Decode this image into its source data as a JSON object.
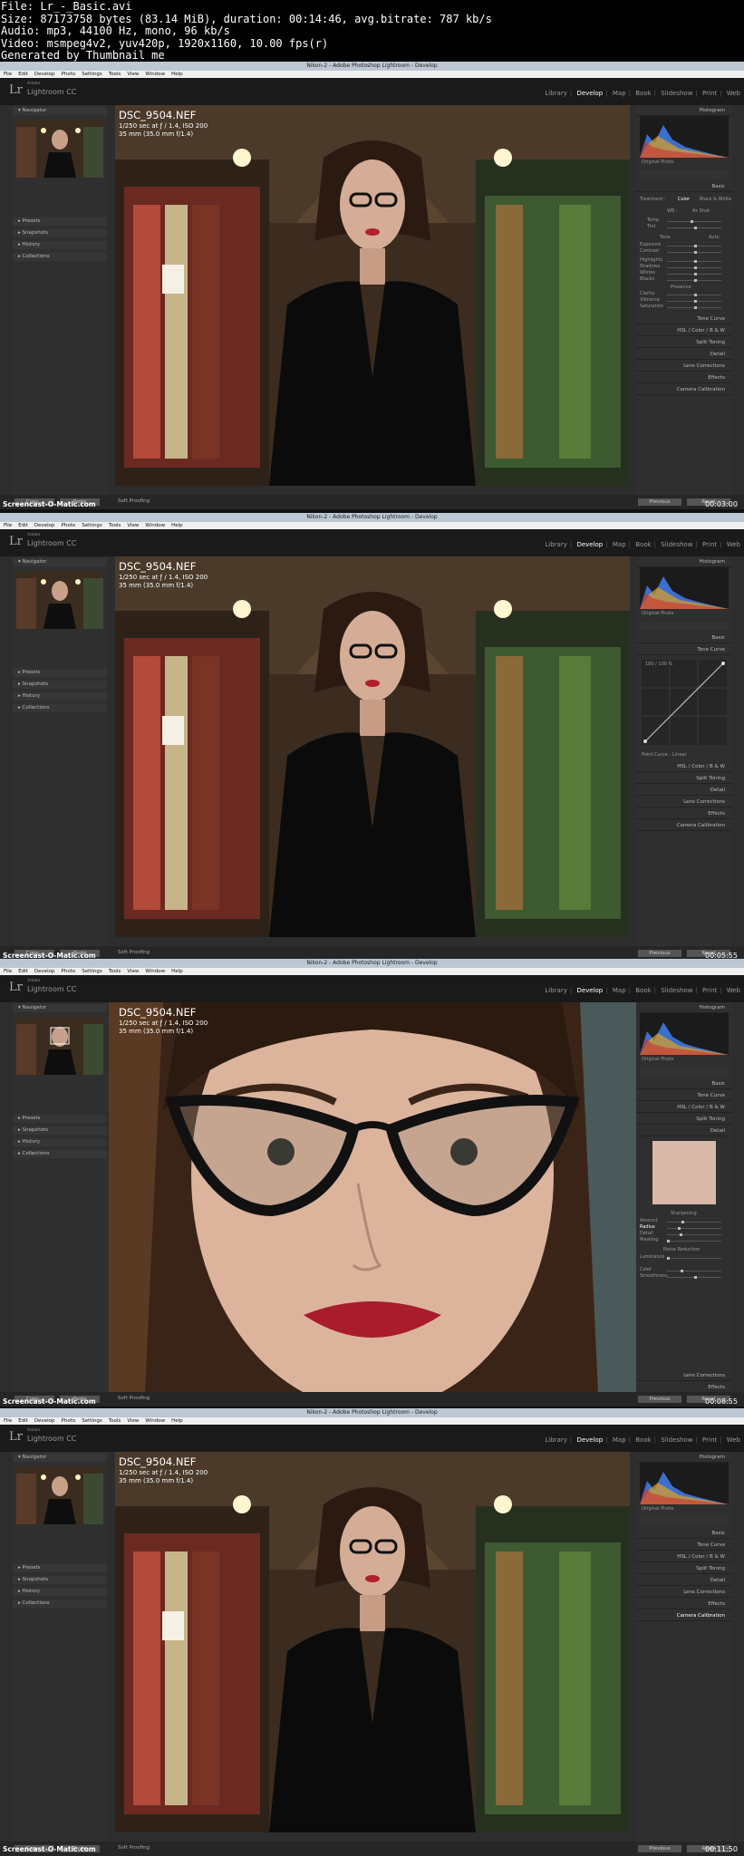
{
  "file_info": {
    "line1": "File: Lr_-_Basic.avi",
    "line2": "Size: 87173758 bytes (83.14 MiB), duration: 00:14:46, avg.bitrate: 787 kb/s",
    "line3": "Audio: mp3, 44100 Hz, mono, 96 kb/s",
    "line4": "Video: msmpeg4v2, yuv420p, 1920x1160, 10.00 fps(r)",
    "line5": "Generated by Thumbnail me"
  },
  "app": {
    "window_title": "Nikon-2 - Adobe Photoshop Lightroom - Develop",
    "menu": [
      "File",
      "Edit",
      "Develop",
      "Photo",
      "Settings",
      "Tools",
      "View",
      "Window",
      "Help"
    ],
    "logo": "Lr",
    "subtitle": "Adobe",
    "name": "Lightroom CC",
    "modules": [
      "Library",
      "Develop",
      "Map",
      "Book",
      "Slideshow",
      "Print",
      "Web"
    ],
    "active_module": "Develop"
  },
  "left_panel": {
    "navigator": "Navigator",
    "presets": "Presets",
    "snapshots": "Snapshots",
    "history": "History",
    "collections": "Collections"
  },
  "photo_info": {
    "filename": "DSC_9504.NEF",
    "exposure": "1/250 sec at ƒ / 1.4, ISO 200",
    "lens": "35 mm (35.0 mm f/1.4)"
  },
  "right_panel": {
    "histogram": "Histogram",
    "original_photo": "Original Photo",
    "basic": "Basic",
    "tone_curve": "Tone Curve",
    "hsl": "HSL",
    "color": "Color",
    "bw": "B & W",
    "split_toning": "Split Toning",
    "detail": "Detail",
    "lens_corrections": "Lens Corrections",
    "effects": "Effects",
    "camera_calibration": "Camera Calibration",
    "treatment": "Treatment :",
    "treatment_color": "Color",
    "treatment_bw": "Black & White",
    "wb": "WB :",
    "wb_value": "As Shot",
    "temp": "Temp",
    "tint": "Tint",
    "tone": "Tone",
    "auto": "Auto",
    "exposure": "Exposure",
    "contrast": "Contrast",
    "highlights": "Highlights",
    "shadows": "Shadows",
    "whites": "Whites",
    "blacks": "Blacks",
    "presence": "Presence",
    "clarity": "Clarity",
    "vibrance": "Vibrance",
    "saturation": "Saturation",
    "point_curve": "Point Curve :",
    "point_curve_value": "Linear",
    "sharpening": "Sharpening",
    "amount": "Amount",
    "radius": "Radius",
    "detail_s": "Detail",
    "masking": "Masking",
    "noise_reduction": "Noise Reduction",
    "luminance": "Luminance",
    "color_nr": "Color",
    "smoothness": "Smoothness",
    "curve_readout": "100 / 100 %"
  },
  "bottom": {
    "copy": "Copy...",
    "paste": "Paste",
    "soft_proofing": "Soft Proofing",
    "previous": "Previous",
    "reset": "Reset"
  },
  "watermark": "Screencast-O-Matic.com",
  "frames": [
    {
      "timecode": "00:03:00",
      "view": "fit",
      "panel": "basic"
    },
    {
      "timecode": "00:05:55",
      "view": "fit",
      "panel": "tone_curve"
    },
    {
      "timecode": "00:08:55",
      "view": "zoom",
      "panel": "detail"
    },
    {
      "timecode": "00:11:50",
      "view": "fit",
      "panel": "collapsed"
    }
  ],
  "colors": {
    "panel_bg": "#2f2f2f",
    "title_bar": "#bcc7d3",
    "accent_text": "#ffffff"
  }
}
